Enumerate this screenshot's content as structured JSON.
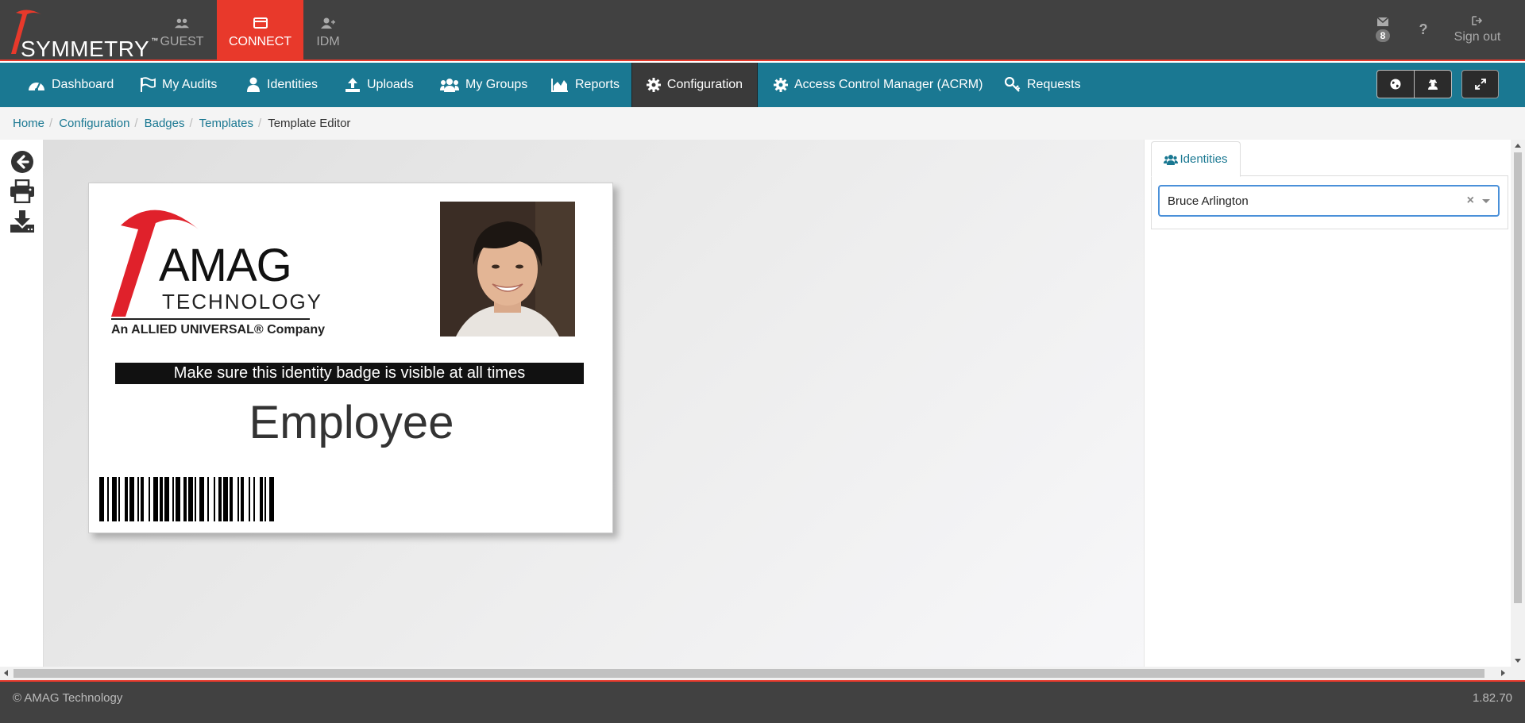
{
  "brand": {
    "app_name": "SYMMETRY",
    "trademark": "™",
    "accent_color": "#e8392b",
    "nav_color": "#1a7892"
  },
  "app_tabs": [
    {
      "label": "GUEST",
      "icon": "users-icon",
      "active": false
    },
    {
      "label": "CONNECT",
      "icon": "card-icon",
      "active": true
    },
    {
      "label": "IDM",
      "icon": "user-plus-icon",
      "active": false
    }
  ],
  "top_right": {
    "mail_count": "8",
    "help_label": "?",
    "signout_label": "Sign out"
  },
  "nav": {
    "items": [
      {
        "label": "Dashboard",
        "icon": "dashboard-icon"
      },
      {
        "label": "My Audits",
        "icon": "flag-icon"
      },
      {
        "label": "Identities",
        "icon": "user-icon"
      },
      {
        "label": "Uploads",
        "icon": "upload-icon"
      },
      {
        "label": "My Groups",
        "icon": "group-icon"
      },
      {
        "label": "Reports",
        "icon": "area-chart-icon"
      },
      {
        "label": "Configuration",
        "icon": "gear-icon",
        "active": true
      },
      {
        "label": "Access Control Manager (ACRM)",
        "icon": "gear-icon"
      },
      {
        "label": "Requests",
        "icon": "key-icon"
      }
    ]
  },
  "breadcrumb": {
    "items": [
      "Home",
      "Configuration",
      "Badges",
      "Templates"
    ],
    "current": "Template Editor"
  },
  "badge": {
    "logo_word": "AMAG",
    "logo_tech": "TECHNOLOGY",
    "logo_sub": "An ALLIED UNIVERSAL® Company",
    "banner_text": "Make sure this identity badge is visible at all times",
    "role": "Employee"
  },
  "right_panel": {
    "tab_label": "Identities",
    "selected_identity": "Bruce Arlington",
    "clear_label": "×"
  },
  "footer": {
    "copyright": "© AMAG Technology",
    "version": "1.82.70"
  }
}
